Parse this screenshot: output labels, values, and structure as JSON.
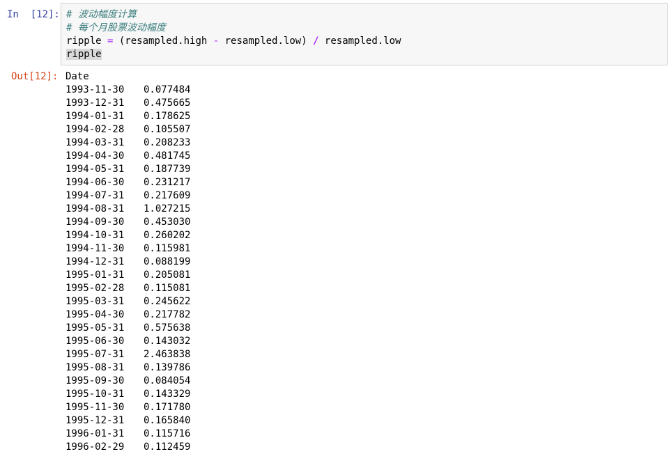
{
  "input_cell": {
    "prompt": "In  [12]:",
    "lines": {
      "comment1": "# 波动幅度计算",
      "comment2": "# 每个月股票波动幅度",
      "l3_a": "ripple ",
      "l3_eq": "=",
      "l3_b": " (resampled.high ",
      "l3_minus": "-",
      "l3_c": " resampled.low) ",
      "l3_div": "/",
      "l3_d": " resampled.low",
      "l4": "ripple"
    }
  },
  "output_cell": {
    "prompt": "Out[12]:",
    "index_name": "Date",
    "rows": [
      {
        "date": "1993-11-30",
        "value": "0.077484"
      },
      {
        "date": "1993-12-31",
        "value": "0.475665"
      },
      {
        "date": "1994-01-31",
        "value": "0.178625"
      },
      {
        "date": "1994-02-28",
        "value": "0.105507"
      },
      {
        "date": "1994-03-31",
        "value": "0.208233"
      },
      {
        "date": "1994-04-30",
        "value": "0.481745"
      },
      {
        "date": "1994-05-31",
        "value": "0.187739"
      },
      {
        "date": "1994-06-30",
        "value": "0.231217"
      },
      {
        "date": "1994-07-31",
        "value": "0.217609"
      },
      {
        "date": "1994-08-31",
        "value": "1.027215"
      },
      {
        "date": "1994-09-30",
        "value": "0.453030"
      },
      {
        "date": "1994-10-31",
        "value": "0.260202"
      },
      {
        "date": "1994-11-30",
        "value": "0.115981"
      },
      {
        "date": "1994-12-31",
        "value": "0.088199"
      },
      {
        "date": "1995-01-31",
        "value": "0.205081"
      },
      {
        "date": "1995-02-28",
        "value": "0.115081"
      },
      {
        "date": "1995-03-31",
        "value": "0.245622"
      },
      {
        "date": "1995-04-30",
        "value": "0.217782"
      },
      {
        "date": "1995-05-31",
        "value": "0.575638"
      },
      {
        "date": "1995-06-30",
        "value": "0.143032"
      },
      {
        "date": "1995-07-31",
        "value": "2.463838"
      },
      {
        "date": "1995-08-31",
        "value": "0.139786"
      },
      {
        "date": "1995-09-30",
        "value": "0.084054"
      },
      {
        "date": "1995-10-31",
        "value": "0.143329"
      },
      {
        "date": "1995-11-30",
        "value": "0.171780"
      },
      {
        "date": "1995-12-31",
        "value": "0.165840"
      },
      {
        "date": "1996-01-31",
        "value": "0.115716"
      },
      {
        "date": "1996-02-29",
        "value": "0.112459"
      }
    ]
  }
}
